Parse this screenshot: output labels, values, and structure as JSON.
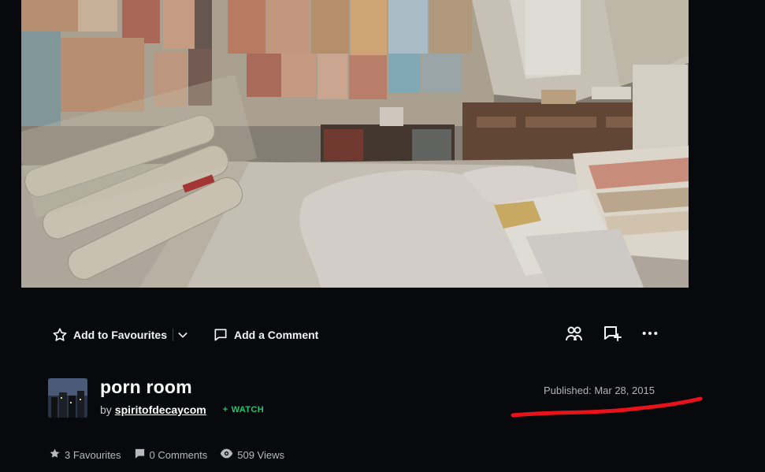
{
  "artwork": {
    "alt": ""
  },
  "actions": {
    "add_to_favourites": "Add to Favourites",
    "add_comment": "Add a Comment"
  },
  "deviation": {
    "title": "porn room",
    "by_prefix": "by",
    "author": "spiritofdecaycom",
    "watch_label": "WATCH",
    "watch_plus": "+",
    "published": "Published: Mar 28, 2015"
  },
  "stats": {
    "favourites": "3 Favourites",
    "comments": "0 Comments",
    "views": "509 Views"
  },
  "colors": {
    "background": "#07090c",
    "watch_accent": "#22c46e",
    "annotation_red": "#e8121b"
  },
  "icons": [
    "star-icon",
    "chevron-down-icon",
    "comment-icon",
    "share-icon",
    "collection-add-icon",
    "more-icon",
    "favourite-stat-icon",
    "comment-stat-icon",
    "eye-icon",
    "plus-icon"
  ]
}
